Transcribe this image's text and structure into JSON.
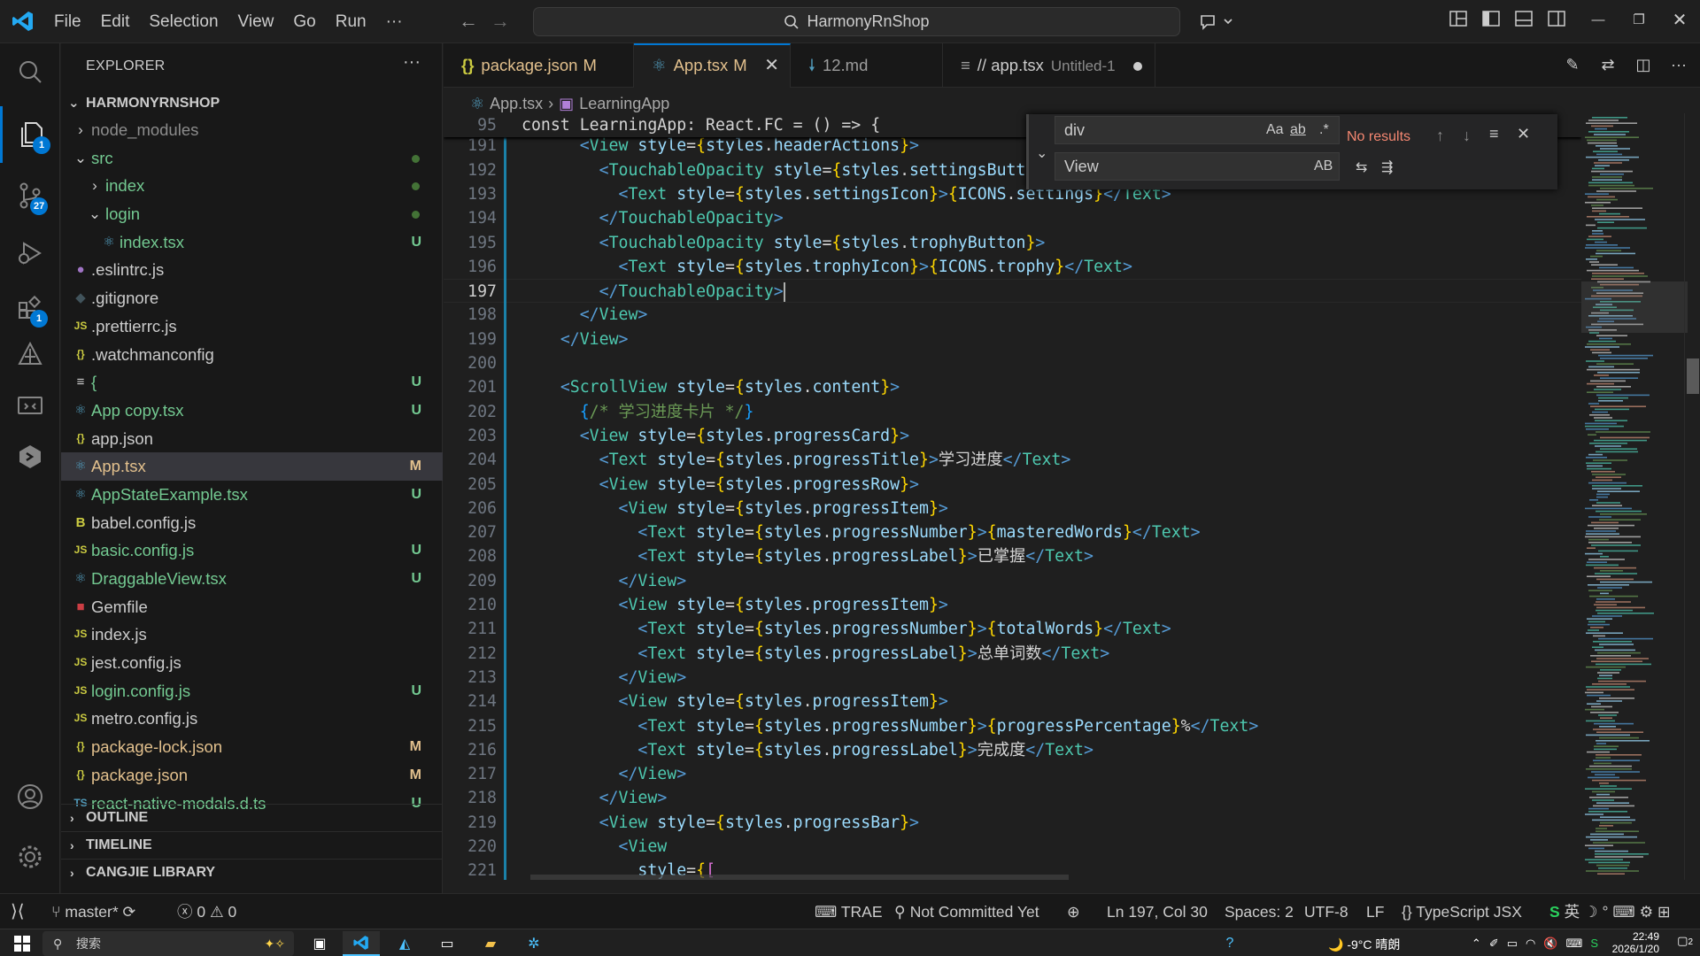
{
  "menu": [
    "File",
    "Edit",
    "Selection",
    "View",
    "Go",
    "Run",
    "···"
  ],
  "command_center": {
    "label": "HarmonyRnShop"
  },
  "activity_badges": {
    "explorer": "1",
    "source_control": "27",
    "extensions": "1"
  },
  "explorer": {
    "title": "EXPLORER",
    "root": "HARMONYRNSHOP",
    "items": [
      {
        "name": "node_modules",
        "type": "folder",
        "depth": 1,
        "open": false,
        "status": "",
        "color": "#8c8c8c"
      },
      {
        "name": "src",
        "type": "folder",
        "depth": 1,
        "open": true,
        "status": "dot",
        "color": "#73c991"
      },
      {
        "name": "index",
        "type": "folder",
        "depth": 2,
        "open": false,
        "status": "dot",
        "color": "#73c991"
      },
      {
        "name": "login",
        "type": "folder",
        "depth": 2,
        "open": true,
        "status": "dot",
        "color": "#73c991"
      },
      {
        "name": "index.tsx",
        "type": "react",
        "depth": 3,
        "status": "U",
        "color": "#73c991"
      },
      {
        "name": ".eslintrc.js",
        "type": "eslint",
        "depth": 1,
        "status": "",
        "color": "#cccccc"
      },
      {
        "name": ".gitignore",
        "type": "git",
        "depth": 1,
        "status": "",
        "color": "#cccccc"
      },
      {
        "name": ".prettierrc.js",
        "type": "js",
        "depth": 1,
        "status": "",
        "color": "#cccccc"
      },
      {
        "name": ".watchmanconfig",
        "type": "json",
        "depth": 1,
        "status": "",
        "color": "#cccccc"
      },
      {
        "name": "{",
        "type": "text",
        "depth": 1,
        "status": "U",
        "color": "#73c991"
      },
      {
        "name": "App copy.tsx",
        "type": "react",
        "depth": 1,
        "status": "U",
        "color": "#73c991"
      },
      {
        "name": "app.json",
        "type": "json",
        "depth": 1,
        "status": "",
        "color": "#cccccc"
      },
      {
        "name": "App.tsx",
        "type": "react",
        "depth": 1,
        "status": "M",
        "color": "#e2c08d",
        "selected": true
      },
      {
        "name": "AppStateExample.tsx",
        "type": "react",
        "depth": 1,
        "status": "U",
        "color": "#73c991"
      },
      {
        "name": "babel.config.js",
        "type": "babel",
        "depth": 1,
        "status": "",
        "color": "#cccccc"
      },
      {
        "name": "basic.config.js",
        "type": "js",
        "depth": 1,
        "status": "U",
        "color": "#73c991"
      },
      {
        "name": "DraggableView.tsx",
        "type": "react",
        "depth": 1,
        "status": "U",
        "color": "#73c991"
      },
      {
        "name": "Gemfile",
        "type": "ruby",
        "depth": 1,
        "status": "",
        "color": "#cccccc"
      },
      {
        "name": "index.js",
        "type": "js",
        "depth": 1,
        "status": "",
        "color": "#cccccc"
      },
      {
        "name": "jest.config.js",
        "type": "js",
        "depth": 1,
        "status": "",
        "color": "#cccccc"
      },
      {
        "name": "login.config.js",
        "type": "js",
        "depth": 1,
        "status": "U",
        "color": "#73c991"
      },
      {
        "name": "metro.config.js",
        "type": "js",
        "depth": 1,
        "status": "",
        "color": "#cccccc"
      },
      {
        "name": "package-lock.json",
        "type": "json",
        "depth": 1,
        "status": "M",
        "color": "#e2c08d"
      },
      {
        "name": "package.json",
        "type": "json",
        "depth": 1,
        "status": "M",
        "color": "#e2c08d"
      },
      {
        "name": "react-native-modals.d.ts",
        "type": "ts",
        "depth": 1,
        "status": "U",
        "color": "#73c991"
      }
    ],
    "sections": [
      "OUTLINE",
      "TIMELINE",
      "CANGJIE LIBRARY"
    ]
  },
  "tabs": [
    {
      "label": "package.json",
      "status": "M",
      "icon": "{}"
    },
    {
      "label": "App.tsx",
      "status": "M",
      "icon": "react",
      "active": true
    },
    {
      "label": "12.md",
      "status": "",
      "icon": "md"
    },
    {
      "label": "// app.tsx",
      "status": "Untitled-1",
      "icon": "lines",
      "dirty": true
    }
  ],
  "breadcrumb": [
    "App.tsx",
    "LearningApp"
  ],
  "find": {
    "query": "div",
    "replace": "View",
    "result": "No results"
  },
  "code": {
    "sticky": {
      "num": "95",
      "text": "const LearningApp: React.FC = () => {"
    },
    "current_line": "197",
    "lines": [
      {
        "num": "191",
        "text": "      <View style={styles.headerActions}>"
      },
      {
        "num": "192",
        "text": "        <TouchableOpacity style={styles.settingsButton}>"
      },
      {
        "num": "193",
        "text": "          <Text style={styles.settingsIcon}>{ICONS.settings}</Text>"
      },
      {
        "num": "194",
        "text": "        </TouchableOpacity>"
      },
      {
        "num": "195",
        "text": "        <TouchableOpacity style={styles.trophyButton}>"
      },
      {
        "num": "196",
        "text": "          <Text style={styles.trophyIcon}>{ICONS.trophy}</Text>"
      },
      {
        "num": "197",
        "text": "        </TouchableOpacity>"
      },
      {
        "num": "198",
        "text": "      </View>"
      },
      {
        "num": "199",
        "text": "    </View>"
      },
      {
        "num": "200",
        "text": ""
      },
      {
        "num": "201",
        "text": "    <ScrollView style={styles.content}>"
      },
      {
        "num": "202",
        "text": "      {/* 学习进度卡片 */}"
      },
      {
        "num": "203",
        "text": "      <View style={styles.progressCard}>"
      },
      {
        "num": "204",
        "text": "        <Text style={styles.progressTitle}>学习进度</Text>"
      },
      {
        "num": "205",
        "text": "        <View style={styles.progressRow}>"
      },
      {
        "num": "206",
        "text": "          <View style={styles.progressItem}>"
      },
      {
        "num": "207",
        "text": "            <Text style={styles.progressNumber}>{masteredWords}</Text>"
      },
      {
        "num": "208",
        "text": "            <Text style={styles.progressLabel}>已掌握</Text>"
      },
      {
        "num": "209",
        "text": "          </View>"
      },
      {
        "num": "210",
        "text": "          <View style={styles.progressItem}>"
      },
      {
        "num": "211",
        "text": "            <Text style={styles.progressNumber}>{totalWords}</Text>"
      },
      {
        "num": "212",
        "text": "            <Text style={styles.progressLabel}>总单词数</Text>"
      },
      {
        "num": "213",
        "text": "          </View>"
      },
      {
        "num": "214",
        "text": "          <View style={styles.progressItem}>"
      },
      {
        "num": "215",
        "text": "            <Text style={styles.progressNumber}>{progressPercentage}%</Text>"
      },
      {
        "num": "216",
        "text": "            <Text style={styles.progressLabel}>完成度</Text>"
      },
      {
        "num": "217",
        "text": "          </View>"
      },
      {
        "num": "218",
        "text": "        </View>"
      },
      {
        "num": "219",
        "text": "        <View style={styles.progressBar}>"
      },
      {
        "num": "220",
        "text": "          <View"
      },
      {
        "num": "221",
        "text": "            style={["
      }
    ]
  },
  "status": {
    "branch": "master*",
    "errors": "0",
    "warnings": "0",
    "trae": "TRAE",
    "blame": "Not Committed Yet",
    "position": "Ln 197, Col 30",
    "spaces": "Spaces: 2",
    "encoding": "UTF-8",
    "eol": "LF",
    "language": "TypeScript JSX",
    "ime": "英"
  },
  "taskbar": {
    "search": "搜索",
    "weather": "-9°C",
    "weather_desc": "晴朗",
    "time": "22:49",
    "date": "2026/1/20",
    "notifications": "2"
  }
}
